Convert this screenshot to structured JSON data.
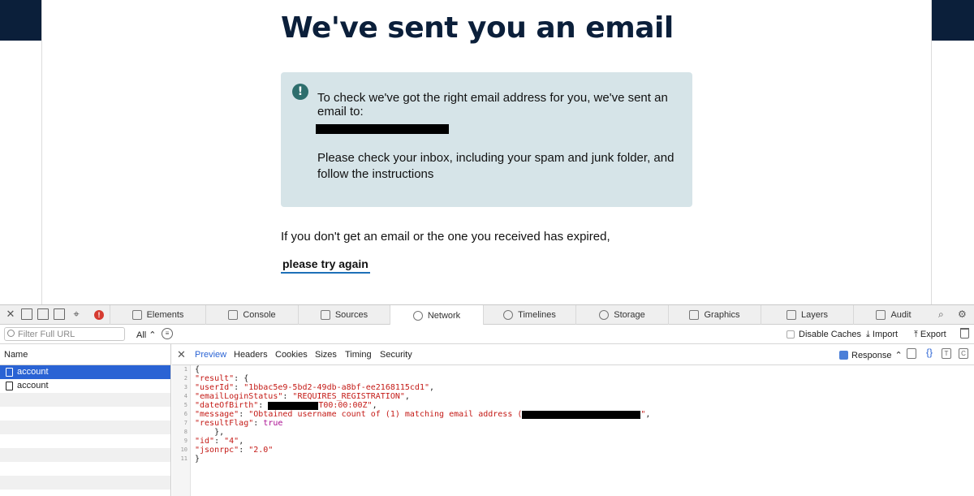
{
  "page": {
    "title": "We've sent you an email",
    "notice": {
      "line1": "To check we've got the right email address for you, we've sent an email to:",
      "line2": "Please check your inbox, including your spam and junk folder, and follow the instructions"
    },
    "expired_text": "If you don't get an email or the one you received has expired,",
    "try_again": "please try again",
    "colors": {
      "brand_dark": "#0b1f3a",
      "notice_bg": "#d6e4e8",
      "link_underline": "#1d70b8"
    }
  },
  "devtools": {
    "tabs": [
      {
        "label": "Elements",
        "icon": "elements-icon"
      },
      {
        "label": "Console",
        "icon": "console-icon"
      },
      {
        "label": "Sources",
        "icon": "sources-icon"
      },
      {
        "label": "Network",
        "icon": "network-icon",
        "active": true
      },
      {
        "label": "Timelines",
        "icon": "timelines-icon"
      },
      {
        "label": "Storage",
        "icon": "storage-icon"
      },
      {
        "label": "Graphics",
        "icon": "graphics-icon"
      },
      {
        "label": "Layers",
        "icon": "layers-icon"
      },
      {
        "label": "Audit",
        "icon": "audit-icon"
      }
    ],
    "filter": {
      "placeholder": "Filter Full URL",
      "type_select": "All",
      "disable_caches": "Disable Caches",
      "import": "Import",
      "export": "Export"
    },
    "requests": {
      "header": "Name",
      "items": [
        "account",
        "account"
      ]
    },
    "response_tabs": [
      "Preview",
      "Headers",
      "Cookies",
      "Sizes",
      "Timing",
      "Security"
    ],
    "response_mode": "Response",
    "code": {
      "line_numbers": [
        "1",
        "2",
        "3",
        "4",
        "5",
        "6",
        "7",
        "8",
        "9",
        "10",
        "11"
      ],
      "open_brace": "{",
      "result_key": "\"result\"",
      "user_id_key": "\"userId\"",
      "user_id_val": "\"1bbac5e9-5bd2-49db-a8bf-ee2168115cd1\"",
      "email_status_key": "\"emailLoginStatus\"",
      "email_status_val": "\"REQUIRES_REGISTRATION\"",
      "dob_key": "\"dateOfBirth\"",
      "dob_val_suffix": "T00:00:00Z\"",
      "message_key": "\"message\"",
      "message_val_prefix": "\"Obtained username count of (1) matching email address (",
      "message_val_suffix": "\"",
      "result_flag_key": "\"resultFlag\"",
      "result_flag_val": "true",
      "id_key": "\"id\"",
      "id_val": "\"4\"",
      "jsonrpc_key": "\"jsonrpc\"",
      "jsonrpc_val": "\"2.0\"",
      "close_brace": "}"
    }
  }
}
